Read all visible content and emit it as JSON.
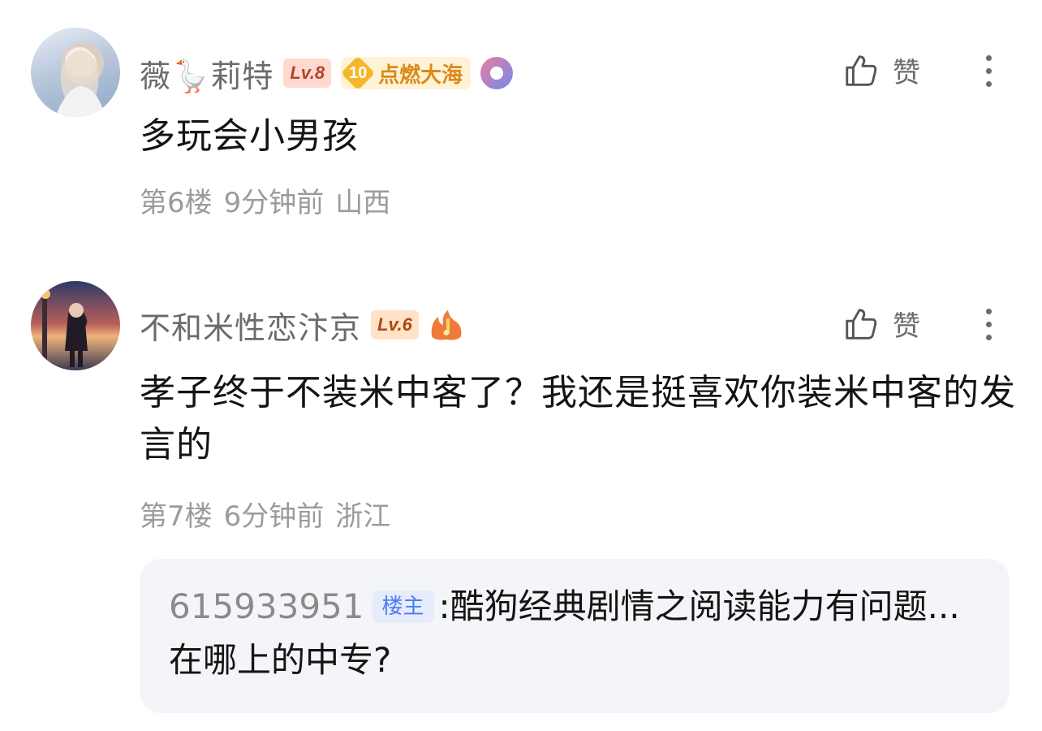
{
  "comments": [
    {
      "username": "薇🪿莉特",
      "level": "Lv.8",
      "fan_badge": {
        "level": "10",
        "name": "点燃大海"
      },
      "like_label": "赞",
      "content": "多玩会小男孩",
      "meta": {
        "floor": "第6楼",
        "time": "9分钟前",
        "location": "山西"
      }
    },
    {
      "username": "不和米性恋汴京",
      "level": "Lv.6",
      "like_label": "赞",
      "content": "孝子终于不装米中客了？我还是挺喜欢你装米中客的发言的",
      "meta": {
        "floor": "第7楼",
        "time": "6分钟前",
        "location": "浙江"
      },
      "reply": {
        "user": "615933951",
        "tag": "楼主",
        "text": ":酷狗经典剧情之阅读能力有问题...在哪上的中专?"
      }
    }
  ],
  "icons": [
    "thumbs-up-icon",
    "more-vertical-icon",
    "fire-icon",
    "badge-icon"
  ],
  "colors": {
    "level_badge": "#ffd9cf",
    "fan_badge": "#fff3d6",
    "host_tag": "#4a7cf0",
    "reply_bg": "#f4f5f8"
  }
}
